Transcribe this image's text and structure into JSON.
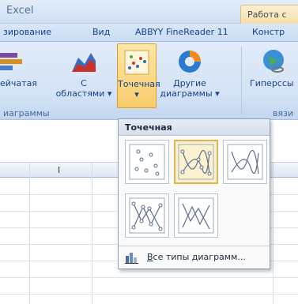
{
  "window": {
    "title": "Excel",
    "context_tab_group": "Работа с"
  },
  "tabs": [
    {
      "label": "зирование"
    },
    {
      "label": "Вид"
    },
    {
      "label": "ABBYY FineReader 11"
    },
    {
      "label": "Констр"
    }
  ],
  "ribbon": {
    "buttons": [
      {
        "label_line1": "ейчатая",
        "label_line2": ""
      },
      {
        "label_line1": "С",
        "label_line2": "областями ▾"
      },
      {
        "label_line1": "Точечная",
        "label_line2": "▾"
      },
      {
        "label_line1": "Другие",
        "label_line2": "диаграммы ▾"
      },
      {
        "label_line1": "Гиперссы",
        "label_line2": ""
      }
    ],
    "group_label": "иаграммы",
    "group_label_right": "вязи"
  },
  "grid": {
    "column_letter": "I"
  },
  "dropdown": {
    "title": "Точечная",
    "thumbnails": [
      {
        "name": "scatter-markers-only"
      },
      {
        "name": "scatter-smooth-lines-markers",
        "selected": true
      },
      {
        "name": "scatter-smooth-lines"
      },
      {
        "name": "scatter-straight-lines-markers"
      },
      {
        "name": "scatter-straight-lines"
      }
    ],
    "all_charts_accel": "В",
    "all_charts_rest": "се типы диаграмм..."
  },
  "colors": {
    "ribbon_text": "#15428b",
    "highlight": "#f9cc6a",
    "selected_border": "#e3b24a"
  }
}
